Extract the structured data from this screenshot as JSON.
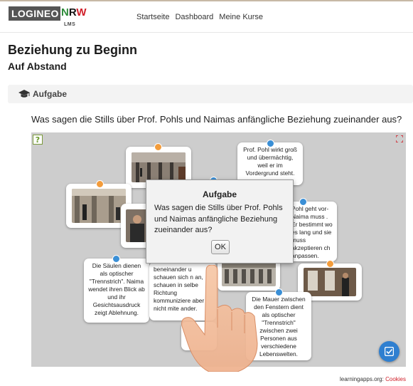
{
  "header": {
    "logo": {
      "main": "LOGINEO",
      "n": "N",
      "r": "R",
      "w": "W",
      "sub": "LMS"
    },
    "nav": [
      "Startseite",
      "Dashboard",
      "Meine Kurse"
    ]
  },
  "page": {
    "title": "Beziehung zu Beginn",
    "subtitle": "Auf Abstand",
    "section_label": "Aufgabe",
    "question": "Was sagen die Stills über Prof. Pohls und Naimas anfängliche Beziehung zueinander aus?"
  },
  "app": {
    "cards": {
      "top_right": "Prof. Pohl wirkt groß und übermächtig, weil er im Vordergrund steht.",
      "right": "Pohl geht vor- Naima muss . Er bestimmt wo es lang und sie muss akzeptieren ch anpassen.",
      "left": "Die Säulen dienen als optischer \"Trennstrich\". Naima wendet ihren Blick ab und ihr Gesichtsausdruck zeigt Ablehnung.",
      "middle": "beneinander u schauen sich n an, schauen in selbe Richtung kommuniziere aber nicht mite ander.",
      "bottom_right": "Die Mauer zwischen den Fenstern dient als optischer \"Trennstrich\" zwischen zwei Personen aus verschiedene Lebenswelten."
    },
    "dialog": {
      "title": "Aufgabe",
      "text": "Was sagen die Stills über Prof. Pohls und Naimas anfängliche Beziehung zueinander aus?",
      "ok": "OK"
    },
    "icons": [
      "question-help-icon",
      "fullscreen-icon",
      "check-icon",
      "graduation-cap-icon",
      "pointing-hand-icon"
    ]
  },
  "footer": {
    "prefix": "learningapps.org:",
    "link": "Cookies"
  },
  "colors": {
    "accent": "#2f7fd0",
    "dot_orange": "#f39c3b",
    "dot_blue": "#3a8fd6",
    "logo_red": "#d0202a",
    "logo_green": "#2e8b3a"
  }
}
